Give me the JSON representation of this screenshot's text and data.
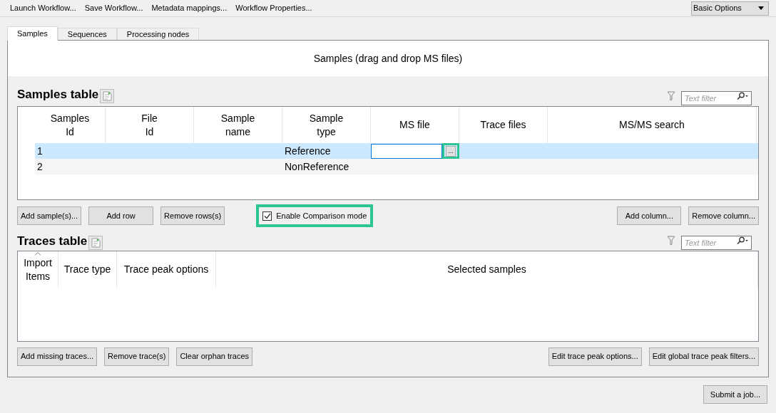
{
  "toolbar": {
    "items": [
      "Launch Workflow...",
      "Save Workflow...",
      "Metadata mappings...",
      "Workflow Properties..."
    ],
    "options_select": {
      "value": "Basic Options"
    }
  },
  "tabs": [
    {
      "label": "Samples",
      "selected": true
    },
    {
      "label": "Sequences",
      "selected": false
    },
    {
      "label": "Processing nodes",
      "selected": false
    }
  ],
  "drop_banner": "Samples (drag and drop MS files)",
  "samples_table": {
    "title": "Samples table",
    "filter": {
      "placeholder": "Text filter"
    },
    "columns": [
      "Samples\nId",
      "File\nId",
      "Sample\nname",
      "Sample\ntype",
      "MS file",
      "Trace files",
      "MS/MS search"
    ],
    "rows": [
      {
        "selected": true,
        "cells": [
          "1",
          "",
          "",
          "Reference",
          "",
          "",
          ""
        ],
        "editing_ms_file": true,
        "browse_button": {
          "label": "...",
          "highlighted": true
        }
      },
      {
        "selected": false,
        "cells": [
          "2",
          "",
          "",
          "NonReference",
          "",
          "",
          ""
        ],
        "editing_ms_file": false
      }
    ],
    "buttons_left": [
      "Add sample(s)...",
      "Add row",
      "Remove rows(s)"
    ],
    "comparison_checkbox": {
      "label": "Enable Comparison mode",
      "checked": true,
      "highlighted": true
    },
    "buttons_right": [
      "Add column...",
      "Remove column..."
    ]
  },
  "traces_table": {
    "title": "Traces table",
    "filter": {
      "placeholder": "Text filter"
    },
    "columns": [
      {
        "label": "Import\nItems",
        "sorted": true
      },
      {
        "label": "Trace type",
        "sorted": false
      },
      {
        "label": "Trace peak options",
        "sorted": false
      },
      {
        "label": "Selected samples",
        "sorted": false
      }
    ],
    "buttons_left": [
      "Add missing traces...",
      "Remove trace(s)",
      "Clear orphan traces"
    ],
    "buttons_right": [
      "Edit trace peak options...",
      "Edit global trace peak filters..."
    ]
  },
  "submit_button": "Submit a job..."
}
